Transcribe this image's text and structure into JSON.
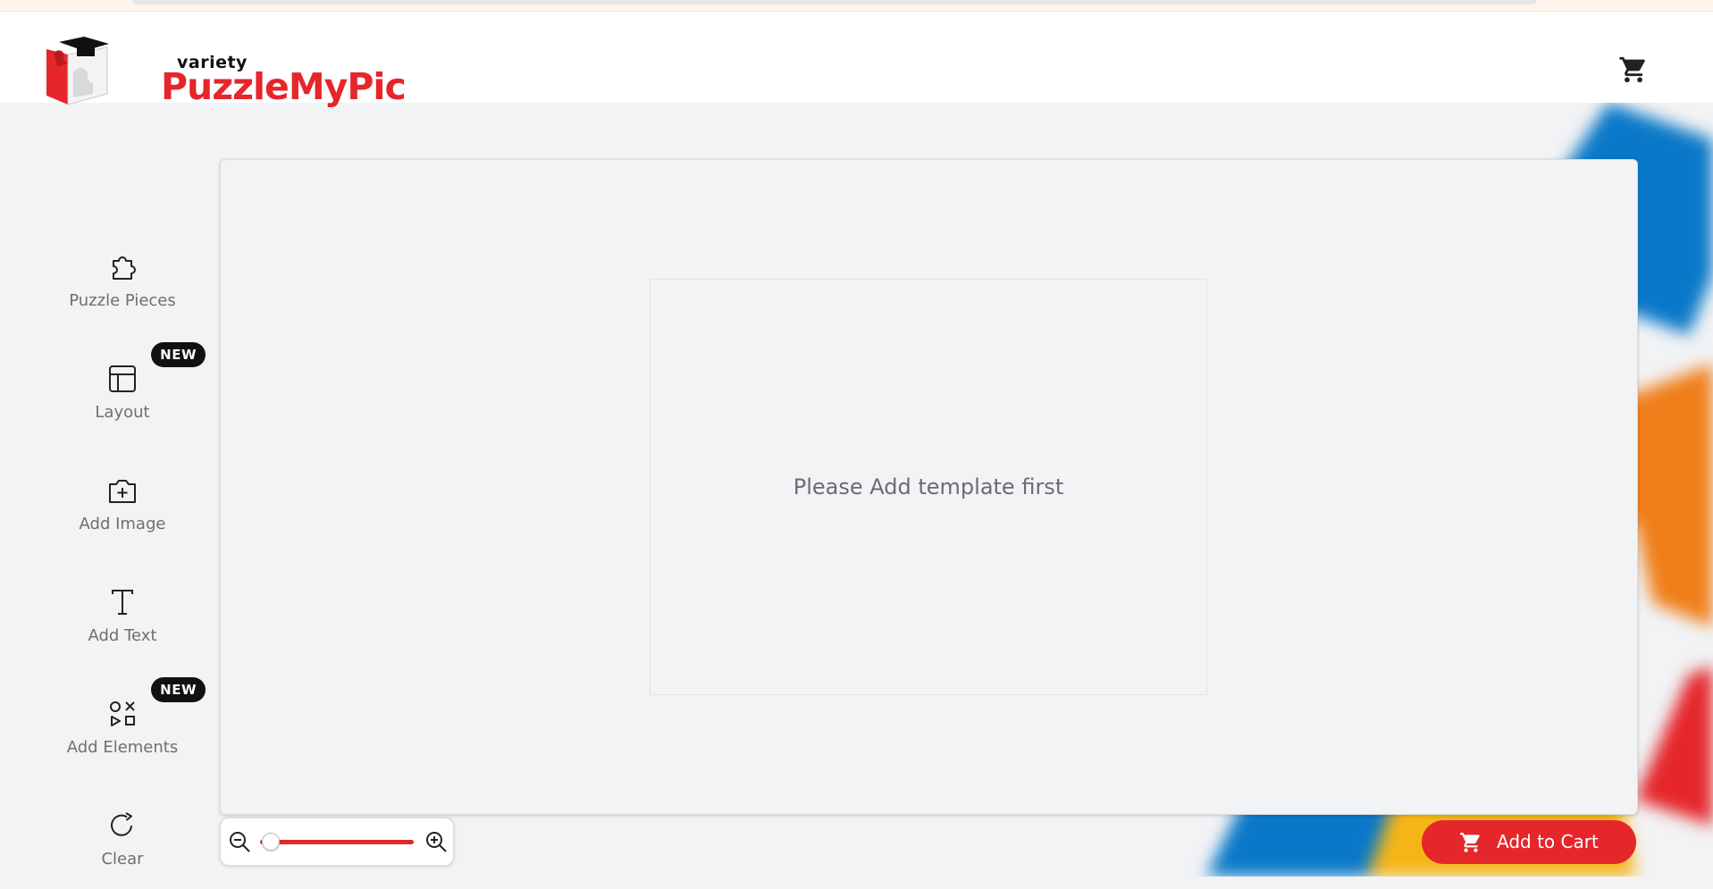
{
  "brand": {
    "name_small": "variety",
    "name_main": "PuzzleMyPic",
    "accent": "#e5262b"
  },
  "header": {
    "cart_icon": "cart-icon"
  },
  "sidebar": {
    "items": [
      {
        "label": "Puzzle Pieces",
        "icon": "puzzle-piece-icon"
      },
      {
        "label": "Layout",
        "icon": "layout-icon",
        "badge": "NEW"
      },
      {
        "label": "Add Image",
        "icon": "add-image-icon"
      },
      {
        "label": "Add Text",
        "icon": "text-icon"
      },
      {
        "label": "Add Elements",
        "icon": "elements-icon",
        "badge": "NEW"
      },
      {
        "label": "Clear",
        "icon": "refresh-icon"
      }
    ]
  },
  "canvas": {
    "placeholder": "Please Add template first"
  },
  "zoom": {
    "level": 0.07
  },
  "cart": {
    "button_label": "Add to Cart"
  }
}
